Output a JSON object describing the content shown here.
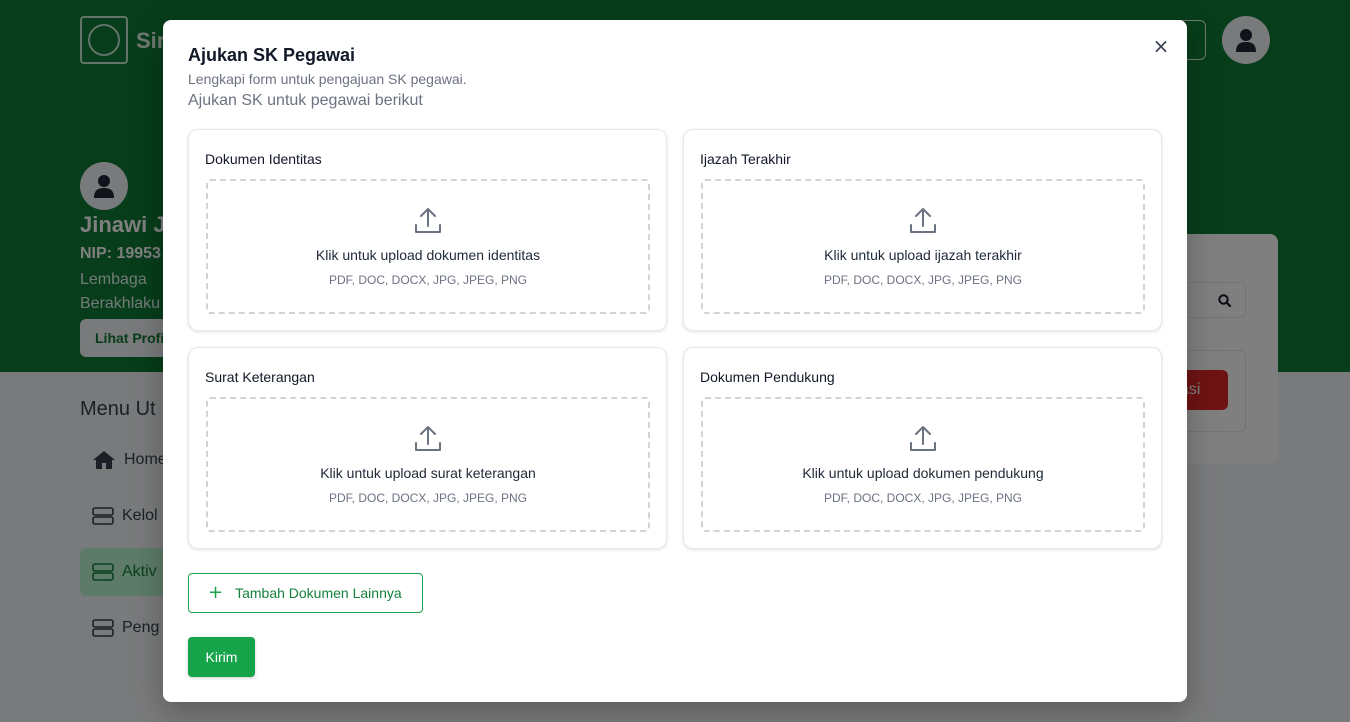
{
  "background": {
    "brand": "Sir",
    "profile": {
      "name": "Jinawi J",
      "nip": "NIP: 19953",
      "org_line1": "Lembaga",
      "org_line2": "Berakhlaku",
      "button": "Lihat Profil"
    },
    "menu": {
      "title": "Menu Ut",
      "items": [
        {
          "label": "Home",
          "icon": "home-icon"
        },
        {
          "label": "Kelol",
          "icon": "server-icon"
        },
        {
          "label": "Aktiv",
          "icon": "server-icon"
        },
        {
          "label": "Peng",
          "icon": "server-icon"
        }
      ]
    },
    "right_button": "asi"
  },
  "modal": {
    "title": "Ajukan SK Pegawai",
    "description": "Lengkapi form untuk pengajuan SK pegawai.",
    "subtitle": "Ajukan SK untuk pegawai berikut",
    "close_icon": "×",
    "documents": [
      {
        "title": "Dokumen Identitas",
        "upload_text": "Klik untuk upload dokumen identitas",
        "formats": "PDF, DOC, DOCX, JPG, JPEG, PNG"
      },
      {
        "title": "Ijazah Terakhir",
        "upload_text": "Klik untuk upload ijazah terakhir",
        "formats": "PDF, DOC, DOCX, JPG, JPEG, PNG"
      },
      {
        "title": "Surat Keterangan",
        "upload_text": "Klik untuk upload surat keterangan",
        "formats": "PDF, DOC, DOCX, JPG, JPEG, PNG"
      },
      {
        "title": "Dokumen Pendukung",
        "upload_text": "Klik untuk upload dokumen pendukung",
        "formats": "PDF, DOC, DOCX, JPG, JPEG, PNG"
      }
    ],
    "add_document_label": "Tambah Dokumen Lainnya",
    "submit_label": "Kirim"
  },
  "colors": {
    "header_green": "#0f7a34",
    "accent_green": "#16a34a",
    "danger_red": "#dc2626"
  }
}
